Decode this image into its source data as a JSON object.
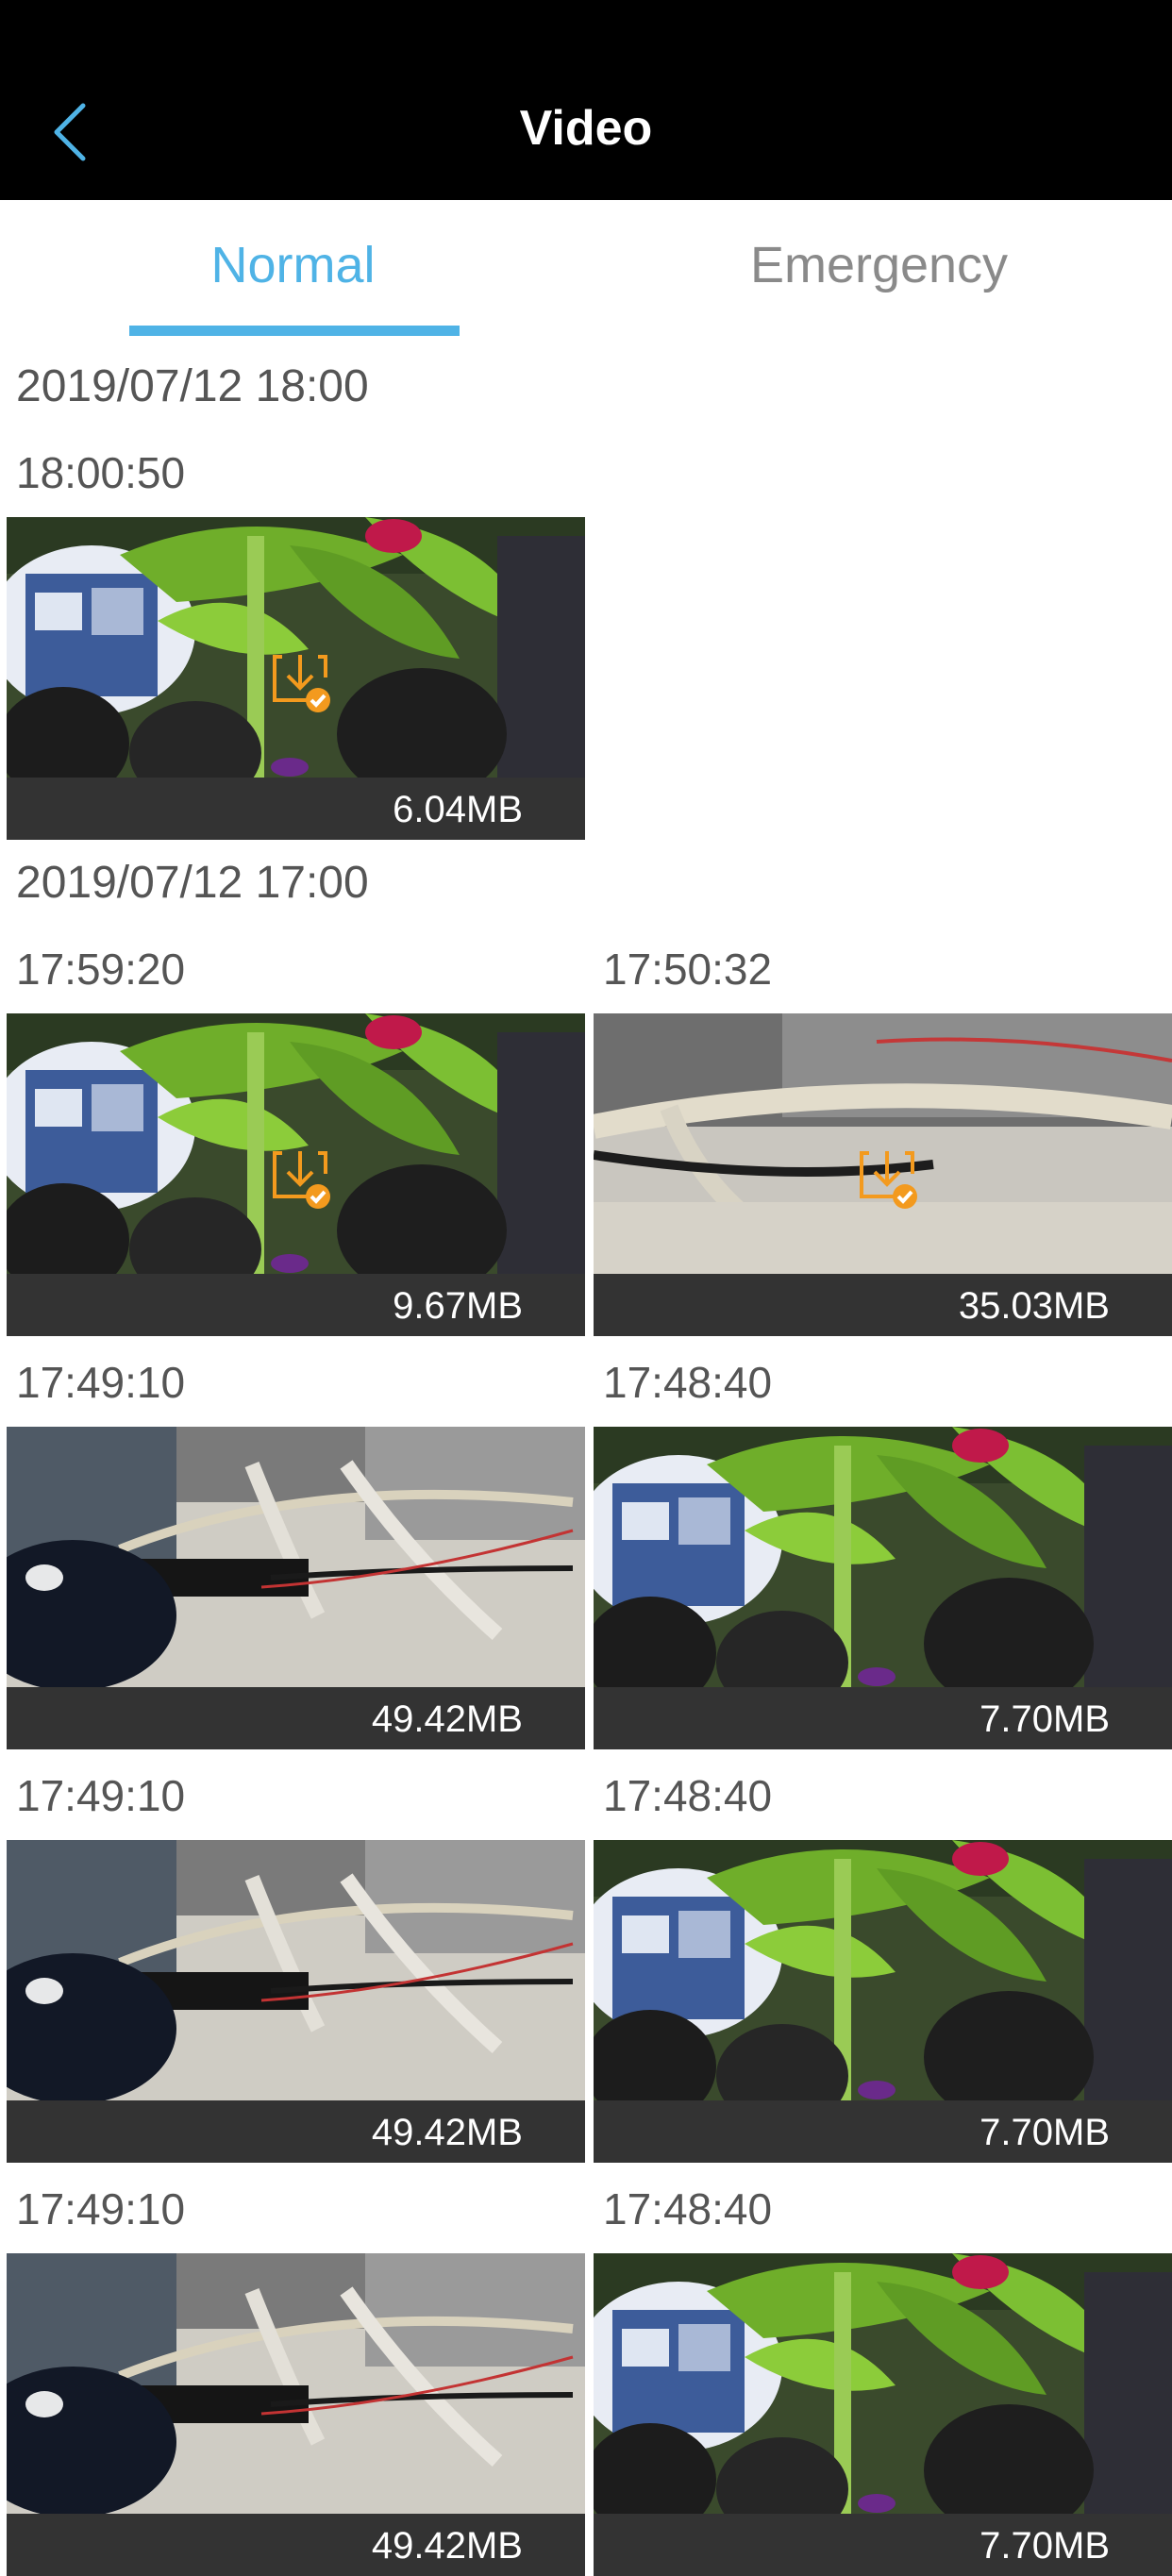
{
  "header": {
    "title": "Video"
  },
  "tabs": [
    {
      "label": "Normal"
    },
    {
      "label": "Emergency"
    }
  ],
  "groups": [
    {
      "label": "2019/07/12 18:00",
      "items": [
        {
          "time": "18:00:50",
          "size": "6.04MB",
          "scene": "plant",
          "downloaded": true
        }
      ]
    },
    {
      "label": "2019/07/12 17:00",
      "items": [
        {
          "time": "17:59:20",
          "size": "9.67MB",
          "scene": "plant",
          "downloaded": true
        },
        {
          "time": "17:50:32",
          "size": "35.03MB",
          "scene": "cables-device",
          "downloaded": true
        },
        {
          "time": "17:49:10",
          "size": "49.42MB",
          "scene": "cables",
          "downloaded": false
        },
        {
          "time": "17:48:40",
          "size": "7.70MB",
          "scene": "plant",
          "downloaded": false
        },
        {
          "time": "17:49:10",
          "size": "49.42MB",
          "scene": "cables",
          "downloaded": false
        },
        {
          "time": "17:48:40",
          "size": "7.70MB",
          "scene": "plant",
          "downloaded": false
        },
        {
          "time": "17:49:10",
          "size": "49.42MB",
          "scene": "cables",
          "downloaded": false
        },
        {
          "time": "17:48:40",
          "size": "7.70MB",
          "scene": "plant",
          "downloaded": false
        }
      ]
    }
  ],
  "icons": {
    "back": "chevron-left-icon",
    "downloaded": "download-complete-icon"
  },
  "colors": {
    "accent": "#4fb3e6",
    "download_icon": "#f39a1e"
  }
}
